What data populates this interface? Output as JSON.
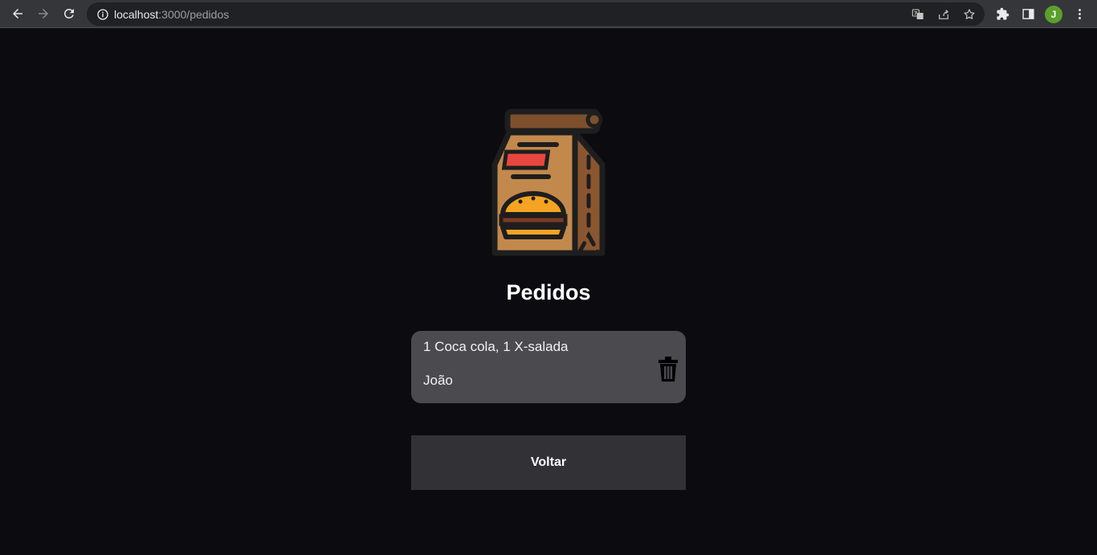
{
  "browser": {
    "url_host": "localhost",
    "url_rest": ":3000/pedidos",
    "profile_initial": "J",
    "accent": "#5aa02c"
  },
  "page": {
    "title": "Pedidos",
    "orders": [
      {
        "items": "1 Coca cola, 1 X-salada",
        "client": "João"
      }
    ],
    "back_label": "Voltar",
    "colors": {
      "background": "#0b0b10",
      "card": "#4a4a4f",
      "button": "#323236"
    }
  }
}
